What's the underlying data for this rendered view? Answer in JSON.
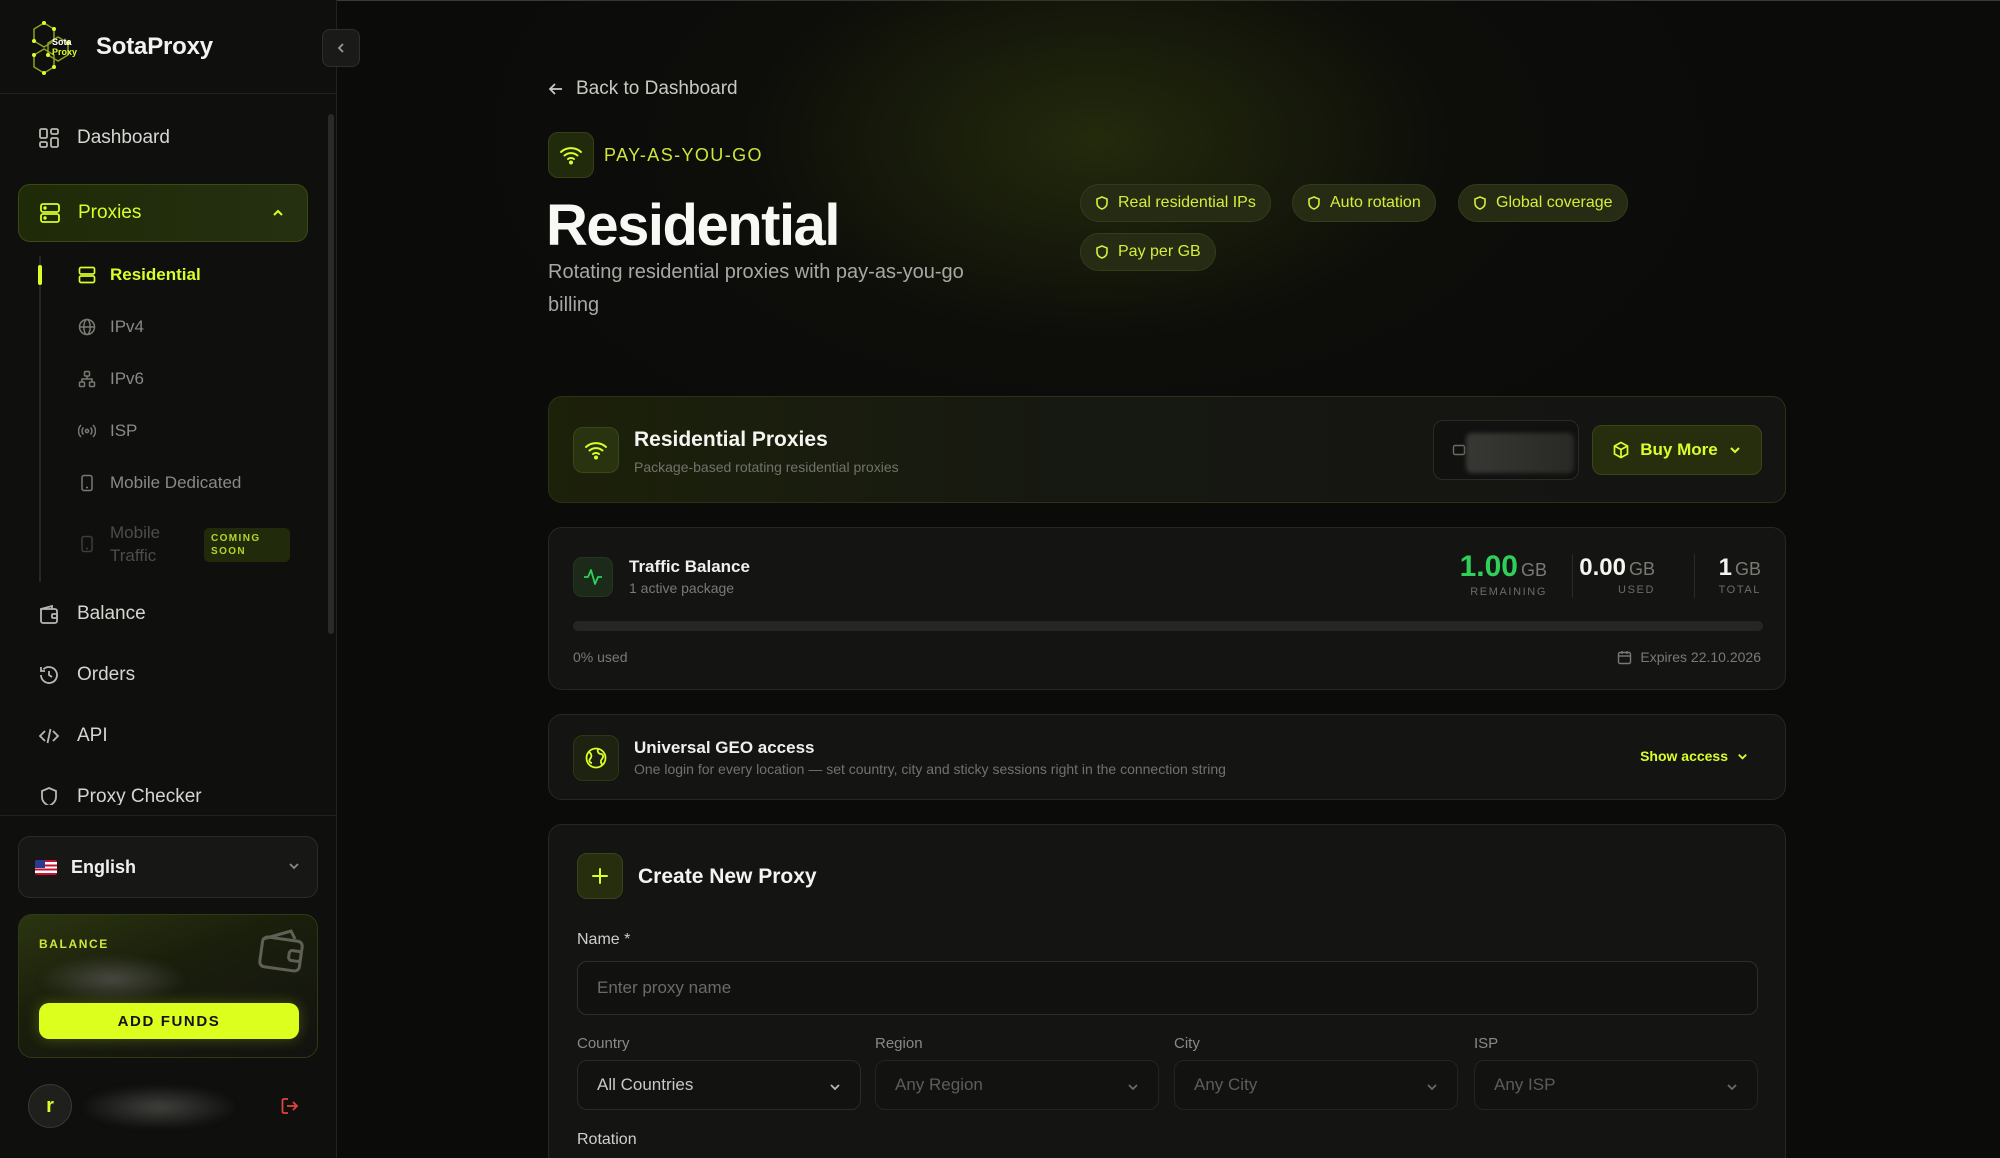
{
  "sidebar": {
    "brand_name": "SotaProxy",
    "logo_text_1": "Sota",
    "logo_text_2": "Proxy",
    "nav": {
      "dashboard": "Dashboard",
      "proxies": "Proxies",
      "balance": "Balance",
      "orders": "Orders",
      "api": "API",
      "proxy_checker": "Proxy Checker"
    },
    "subnav": {
      "residential": "Residential",
      "ipv4": "IPv4",
      "ipv6": "IPv6",
      "isp": "ISP",
      "mobile_dedicated": "Mobile Dedicated",
      "mobile_traffic_1": "Mobile",
      "mobile_traffic_2": "Traffic",
      "coming_1": "COMING",
      "coming_2": "SOON"
    },
    "language": "English",
    "balance_label": "BALANCE",
    "add_funds": "ADD FUNDS",
    "user_initial": "r"
  },
  "main": {
    "back_label": "Back to Dashboard",
    "tag": "PAY-AS-YOU-GO",
    "title": "Residential",
    "subtitle": "Rotating residential proxies with pay-as-you-go billing",
    "features": [
      "Real residential IPs",
      "Auto rotation",
      "Global coverage",
      "Pay per GB"
    ],
    "header_card": {
      "title": "Residential Proxies",
      "subtitle": "Package-based rotating residential proxies",
      "buy_more": "Buy More"
    },
    "traffic": {
      "title": "Traffic Balance",
      "subtitle": "1 active package",
      "remaining_value": "1.00",
      "remaining_unit": "GB",
      "remaining_label": "REMAINING",
      "used_value": "0.00",
      "used_unit": "GB",
      "used_label": "USED",
      "total_value": "1",
      "total_unit": "GB",
      "total_label": "TOTAL",
      "used_fraction": 0,
      "used_text": "0% used",
      "expires": "Expires 22.10.2026"
    },
    "geo": {
      "title": "Universal GEO access",
      "subtitle": "One login for every location — set country, city and sticky sessions right in the connection string",
      "show": "Show access"
    },
    "create": {
      "title": "Create New Proxy",
      "name_label": "Name *",
      "name_placeholder": "Enter proxy name",
      "country_label": "Country",
      "country_value": "All Countries",
      "region_label": "Region",
      "region_value": "Any Region",
      "city_label": "City",
      "city_value": "Any City",
      "isp_label": "ISP",
      "isp_value": "Any ISP",
      "rotation_label": "Rotation"
    }
  },
  "colors": {
    "accent": "#d8ff2a",
    "success": "#2fd05a",
    "background": "#0b0b0a",
    "danger": "#e0443c"
  }
}
